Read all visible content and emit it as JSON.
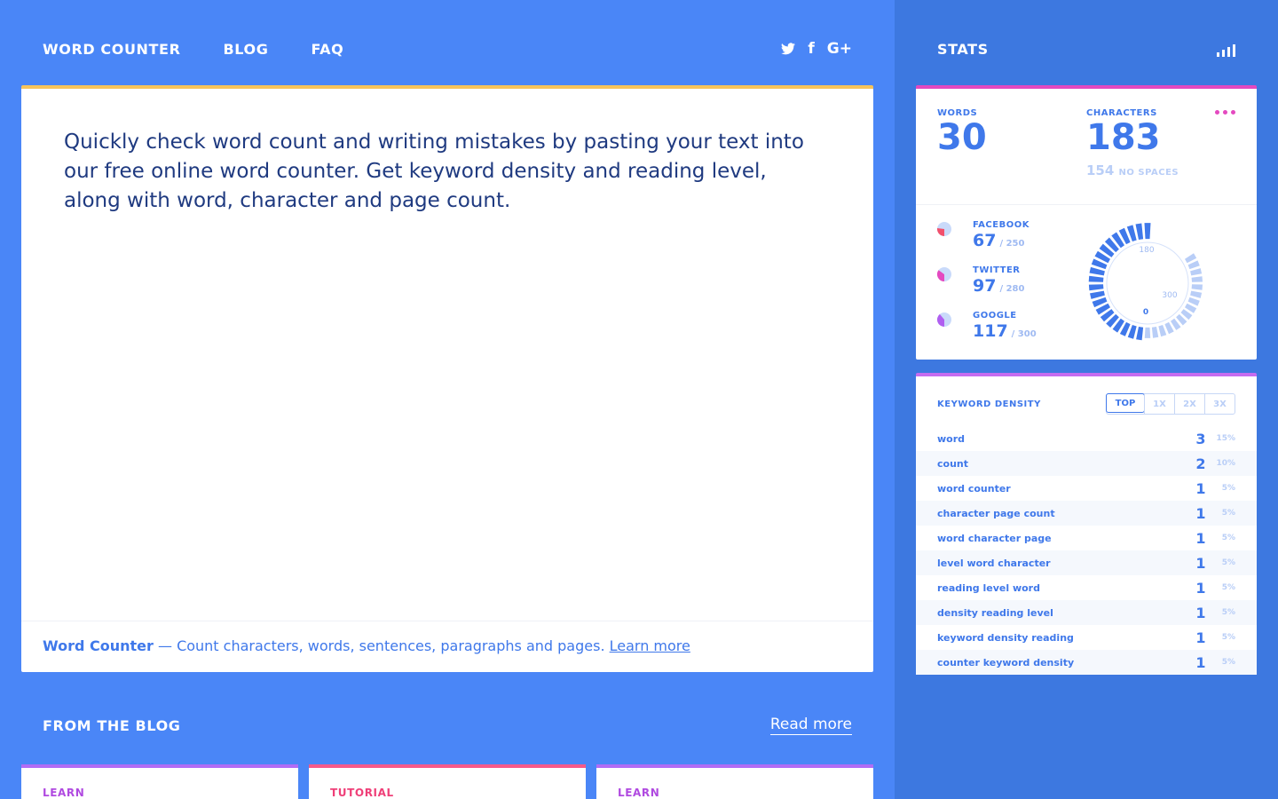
{
  "nav": {
    "items": [
      "WORD COUNTER",
      "BLOG",
      "FAQ"
    ],
    "social": {
      "twitter": "twitter-icon",
      "facebook": "f",
      "google": "G+"
    }
  },
  "editor": {
    "text": "Quickly check word count and writing mistakes by pasting your text into our free online word counter. Get keyword density and reading level, along with word, character and page count.",
    "footer_brand": "Word Counter",
    "footer_text": " — Count characters, words, sentences, paragraphs and pages. ",
    "footer_link": "Learn more"
  },
  "blog": {
    "title": "FROM THE BLOG",
    "read_more": "Read more",
    "cards": [
      "LEARN",
      "TUTORIAL",
      "LEARN"
    ]
  },
  "stats": {
    "title": "STATS",
    "words_label": "WORDS",
    "words": "30",
    "chars_label": "CHARACTERS",
    "chars": "183",
    "no_spaces_value": "154",
    "no_spaces_label": "NO SPACES",
    "social": [
      {
        "name": "FACEBOOK",
        "value": "67",
        "limit": "/ 250",
        "color": "#f2506c",
        "fraction": 0.27
      },
      {
        "name": "TWITTER",
        "value": "97",
        "limit": "/ 280",
        "color": "#e449c0",
        "fraction": 0.35
      },
      {
        "name": "GOOGLE",
        "value": "117",
        "limit": "/ 300",
        "color": "#b05ef0",
        "fraction": 0.39
      }
    ],
    "gauge": {
      "labels": [
        "180",
        "300",
        "0"
      ],
      "filled_fraction": 0.57,
      "fill_color": "#3f78ea",
      "empty_color": "#b9cef7"
    }
  },
  "keyword_density": {
    "title": "KEYWORD DENSITY",
    "tabs": [
      "TOP",
      "1X",
      "2X",
      "3X"
    ],
    "active_tab": "TOP",
    "rows": [
      {
        "keyword": "word",
        "count": "3",
        "pct": "15%"
      },
      {
        "keyword": "count",
        "count": "2",
        "pct": "10%"
      },
      {
        "keyword": "word counter",
        "count": "1",
        "pct": "5%"
      },
      {
        "keyword": "character page count",
        "count": "1",
        "pct": "5%"
      },
      {
        "keyword": "word character page",
        "count": "1",
        "pct": "5%"
      },
      {
        "keyword": "level word character",
        "count": "1",
        "pct": "5%"
      },
      {
        "keyword": "reading level word",
        "count": "1",
        "pct": "5%"
      },
      {
        "keyword": "density reading level",
        "count": "1",
        "pct": "5%"
      },
      {
        "keyword": "keyword density reading",
        "count": "1",
        "pct": "5%"
      },
      {
        "keyword": "counter keyword density",
        "count": "1",
        "pct": "5%"
      }
    ]
  }
}
